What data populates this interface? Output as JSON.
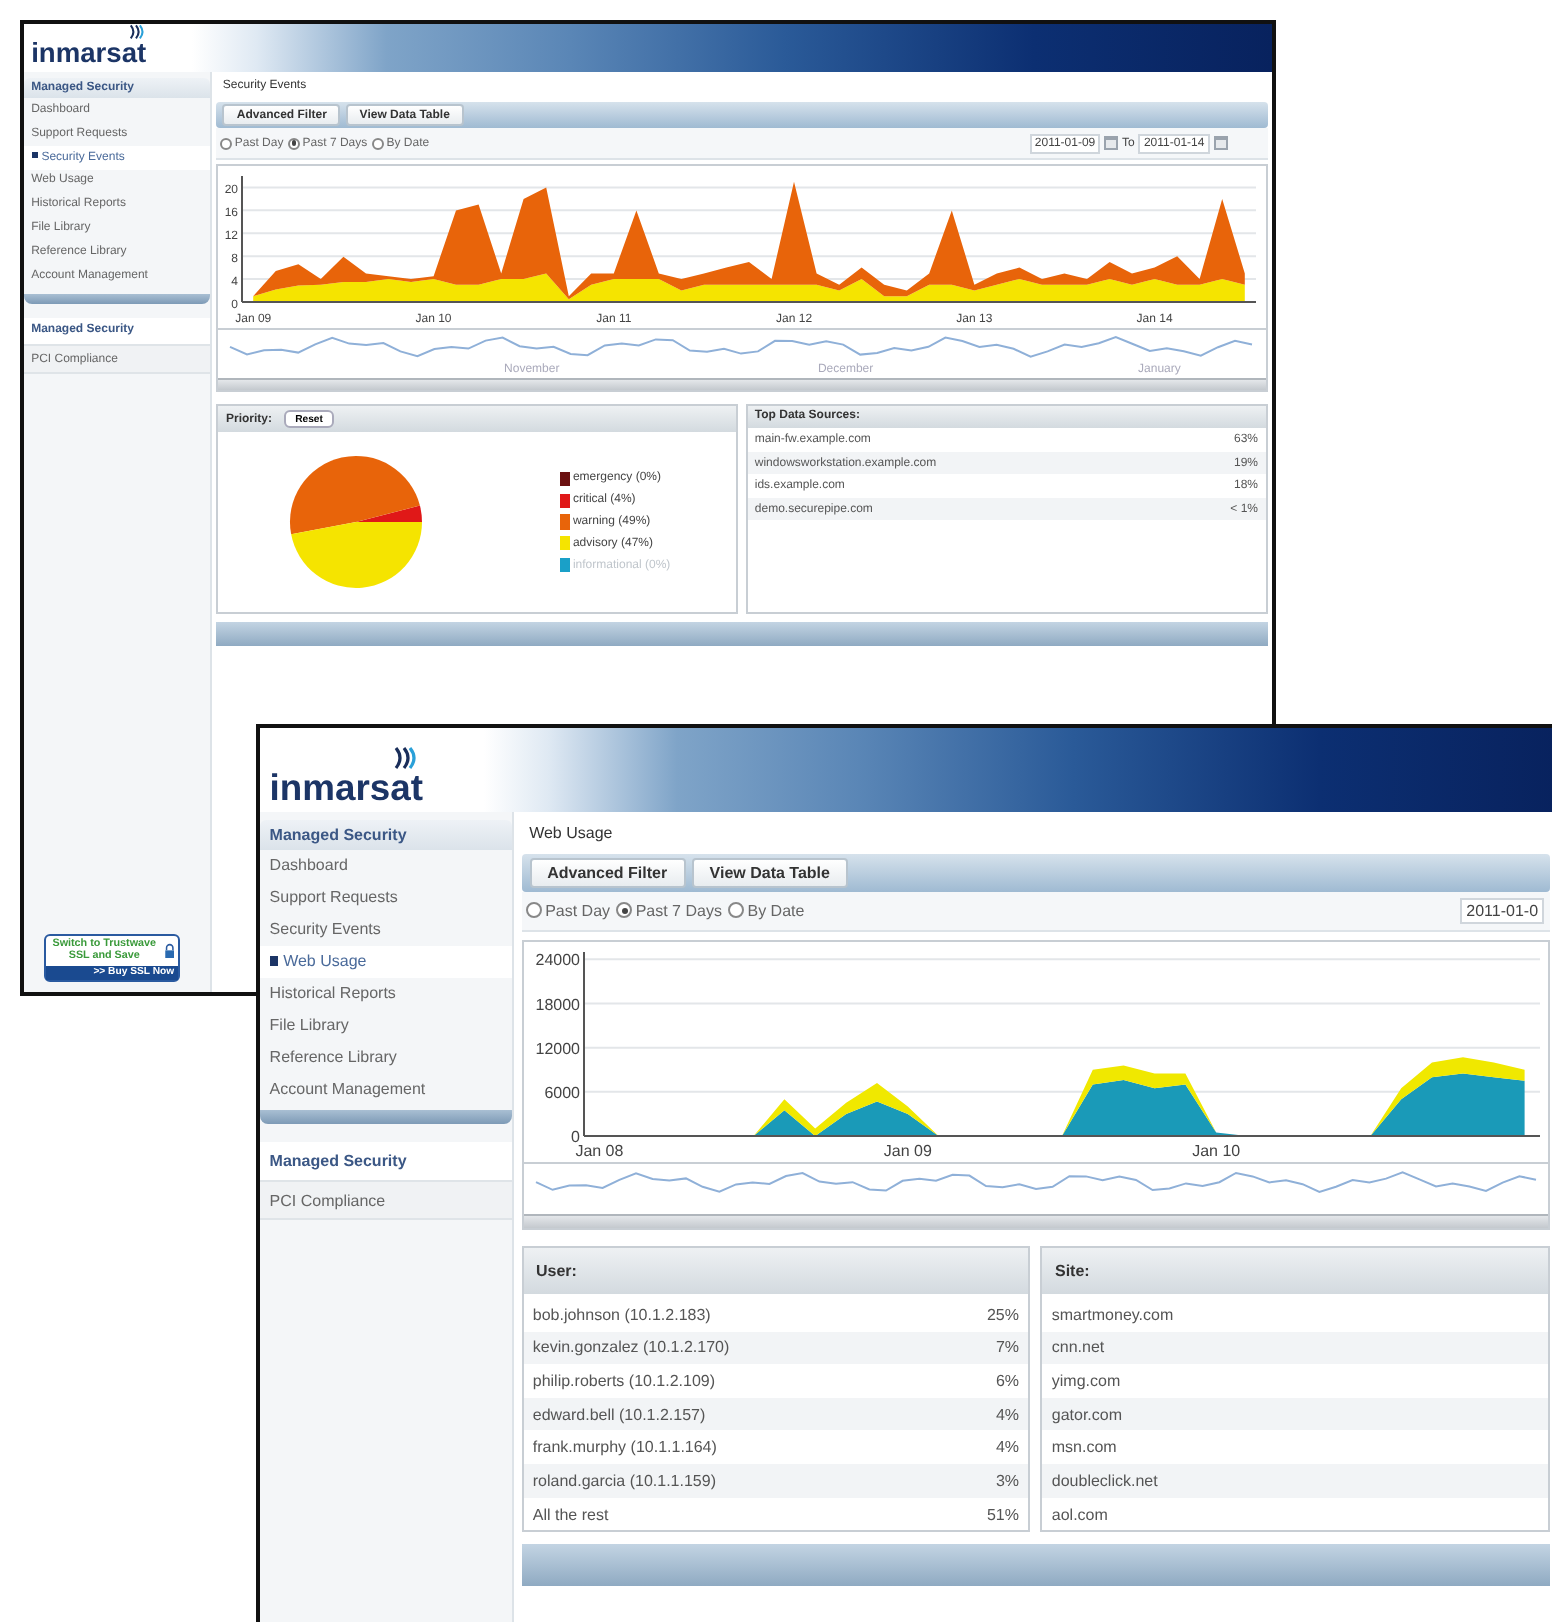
{
  "windows": [
    {
      "kind": "back",
      "logo": "inmarsat",
      "sidebar": {
        "heading": "Managed Security",
        "items": [
          {
            "label": "Dashboard",
            "selected": false
          },
          {
            "label": "Support Requests",
            "selected": false
          },
          {
            "label": "Security Events",
            "selected": true
          },
          {
            "label": "Web Usage",
            "selected": false
          },
          {
            "label": "Historical Reports",
            "selected": false
          },
          {
            "label": "File Library",
            "selected": false
          },
          {
            "label": "Reference Library",
            "selected": false
          },
          {
            "label": "Account Management",
            "selected": false
          }
        ],
        "sections": [
          {
            "label": "Managed Security",
            "kind": "heading"
          },
          {
            "label": "PCI Compliance",
            "kind": "link"
          }
        ]
      },
      "ad": {
        "text": "Switch to Trustwave SSL and Save",
        "action": ">> Buy SSL Now"
      },
      "breadcrumb": "Security Events",
      "buttons": [
        "Advanced Filter",
        "View Data Table"
      ],
      "ranges": [
        {
          "label": "Past Day",
          "selected": false
        },
        {
          "label": "Past 7 Days",
          "selected": true
        },
        {
          "label": "By Date",
          "selected": false
        }
      ],
      "date_from": "2011-01-09",
      "date_to_label": "To",
      "date_to": "2011-01-14",
      "chart_data": {
        "type": "area",
        "stacked": true,
        "grid": true,
        "categories": [
          "Jan 09",
          null,
          null,
          null,
          null,
          null,
          null,
          null,
          "Jan 10",
          null,
          null,
          null,
          null,
          null,
          null,
          null,
          "Jan 11",
          null,
          null,
          null,
          null,
          null,
          null,
          null,
          "Jan 12",
          null,
          null,
          null,
          null,
          null,
          null,
          null,
          "Jan 13",
          null,
          null,
          null,
          null,
          null,
          null,
          null,
          "Jan 14",
          null,
          null,
          null,
          null
        ],
        "ylim": [
          0,
          22
        ],
        "yticks": [
          0,
          4,
          8,
          12,
          16,
          20
        ],
        "series": [
          {
            "color": "#f5e400",
            "values": [
              1,
              2.2,
              2.9,
              3,
              3.5,
              3.5,
              4,
              3.5,
              4,
              3,
              3,
              4,
              4,
              5,
              0.5,
              3,
              4,
              4,
              4,
              2,
              3,
              3,
              3,
              3,
              3,
              3,
              2,
              4,
              1,
              1,
              3,
              3,
              2,
              3,
              4,
              3,
              3,
              3,
              4,
              3,
              4,
              3,
              3,
              4,
              3
            ]
          },
          {
            "color": "#e8640a",
            "values": [
              0,
              3.2,
              3.7,
              1,
              4.4,
              1.5,
              0.5,
              0.5,
              0.5,
              13,
              14,
              1,
              14,
              15,
              0.5,
              2,
              1,
              12,
              1,
              2,
              2,
              3,
              4,
              1,
              18,
              2,
              1,
              2,
              2,
              1,
              2,
              13,
              1,
              2,
              2,
              1,
              2,
              1,
              3,
              2,
              2,
              5,
              1,
              14,
              2
            ]
          }
        ]
      },
      "navigator_months": [
        "November",
        "December",
        "January"
      ],
      "panels": [
        {
          "kind": "pie",
          "title": "Priority:",
          "button": "Reset",
          "chart_data": {
            "type": "pie",
            "values": [
              0,
              4,
              49,
              47,
              0
            ]
          },
          "legend": [
            {
              "label": "emergency (0%)",
              "color": "#6b1010",
              "disabled": false
            },
            {
              "label": "critical (4%)",
              "color": "#e01818",
              "disabled": false
            },
            {
              "label": "warning (49%)",
              "color": "#e8640a",
              "disabled": false
            },
            {
              "label": "advisory (47%)",
              "color": "#f5e400",
              "disabled": false
            },
            {
              "label": "informational (0%)",
              "color": "#1aa0c8",
              "disabled": true
            }
          ]
        },
        {
          "kind": "list",
          "title": "Top Data Sources:",
          "rows": [
            {
              "name": "main-fw.example.com",
              "share": "63%"
            },
            {
              "name": "windowsworkstation.example.com",
              "share": "19%"
            },
            {
              "name": "ids.example.com",
              "share": "18%"
            },
            {
              "name": "demo.securepipe.com",
              "share": "< 1%"
            }
          ]
        }
      ]
    },
    {
      "kind": "front",
      "logo": "inmarsat",
      "sidebar": {
        "heading": "Managed Security",
        "items": [
          {
            "label": "Dashboard",
            "selected": false
          },
          {
            "label": "Support Requests",
            "selected": false
          },
          {
            "label": "Security Events",
            "selected": false
          },
          {
            "label": "Web Usage",
            "selected": true
          },
          {
            "label": "Historical Reports",
            "selected": false
          },
          {
            "label": "File Library",
            "selected": false
          },
          {
            "label": "Reference Library",
            "selected": false
          },
          {
            "label": "Account Management",
            "selected": false
          }
        ],
        "sections": [
          {
            "label": "Managed Security",
            "kind": "heading"
          },
          {
            "label": "PCI Compliance",
            "kind": "link"
          }
        ]
      },
      "breadcrumb": "Web Usage",
      "buttons": [
        "Advanced Filter",
        "View Data Table"
      ],
      "ranges": [
        {
          "label": "Past Day",
          "selected": false
        },
        {
          "label": "Past 7 Days",
          "selected": true
        },
        {
          "label": "By Date",
          "selected": false
        }
      ],
      "date_from": "2011-01-0",
      "chart_data": {
        "type": "area",
        "stacked": true,
        "grid": true,
        "categories": [
          "Jan 08",
          null,
          null,
          null,
          null,
          null,
          null,
          null,
          null,
          null,
          "Jan 09",
          null,
          null,
          null,
          null,
          null,
          null,
          null,
          null,
          null,
          "Jan 10",
          null,
          null,
          null,
          null,
          null,
          null,
          null,
          null,
          null,
          null
        ],
        "ylim": [
          0,
          25000
        ],
        "yticks": [
          0,
          6000,
          12000,
          18000,
          24000
        ],
        "series": [
          {
            "color": "#1a9ab8",
            "values": [
              0,
              0,
              0,
              0,
              0,
              0,
              3500,
              0,
              3000,
              4700,
              3000,
              0,
              0,
              0,
              0,
              0,
              7000,
              7600,
              6500,
              7000,
              500,
              0,
              0,
              0,
              0,
              0,
              5000,
              8000,
              8500,
              8000,
              7500
            ]
          },
          {
            "color": "#f0e800",
            "values": [
              0,
              0,
              0,
              0,
              0,
              0,
              1500,
              1000,
              1500,
              2500,
              1000,
              0,
              0,
              0,
              0,
              0,
              2000,
              2000,
              2000,
              1500,
              0,
              0,
              0,
              0,
              0,
              0,
              1500,
              2000,
              2200,
              2000,
              1500
            ]
          }
        ]
      },
      "panels": [
        {
          "kind": "list",
          "title": "User:",
          "rows": [
            {
              "name": "bob.johnson (10.1.2.183)",
              "share": "25%"
            },
            {
              "name": "kevin.gonzalez (10.1.2.170)",
              "share": "7%"
            },
            {
              "name": "philip.roberts (10.1.2.109)",
              "share": "6%"
            },
            {
              "name": "edward.bell (10.1.2.157)",
              "share": "4%"
            },
            {
              "name": "frank.murphy (10.1.1.164)",
              "share": "4%"
            },
            {
              "name": "roland.garcia (10.1.1.159)",
              "share": "3%"
            },
            {
              "name": "All the rest",
              "share": "51%"
            }
          ]
        },
        {
          "kind": "list",
          "title": "Site:",
          "rows": [
            {
              "name": "smartmoney.com"
            },
            {
              "name": "cnn.net"
            },
            {
              "name": "yimg.com"
            },
            {
              "name": "gator.com"
            },
            {
              "name": "msn.com"
            },
            {
              "name": "doubleclick.net"
            },
            {
              "name": "aol.com"
            }
          ]
        }
      ]
    }
  ]
}
